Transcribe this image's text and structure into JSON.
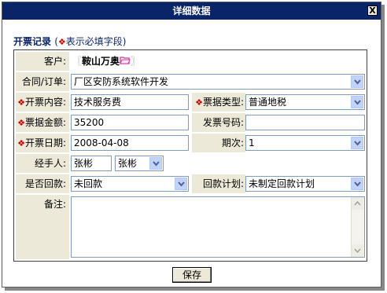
{
  "window": {
    "title": "详细数据",
    "close_label": "X"
  },
  "section": {
    "title": "开票记录",
    "legend_open": "(",
    "legend_mark": "❖",
    "legend_text": "表示必填字段",
    "legend_close": ")"
  },
  "required_mark": "❖",
  "fields": {
    "client": {
      "label": "客户:",
      "bracket_open": "〖",
      "value": "鞍山万奥",
      "bracket_close": "〗"
    },
    "contract": {
      "label": "合同/订单:",
      "value": "厂区安防系统软件开发"
    },
    "invoice_content": {
      "label": "开票内容:",
      "value": "技术服务费"
    },
    "invoice_type": {
      "label": "票据类型:",
      "value": "普通地税"
    },
    "amount": {
      "label": "票据金额:",
      "value": "35200"
    },
    "invoice_number": {
      "label": "发票号码:",
      "value": ""
    },
    "invoice_date": {
      "label": "开票日期:",
      "value": "2008-04-08"
    },
    "period": {
      "label": "期次:",
      "value": "1"
    },
    "handler": {
      "label": "经手人:",
      "value": "张彬",
      "select_value": "张彬"
    },
    "paid_back": {
      "label": "是否回款:",
      "value": "未回款"
    },
    "payback_plan": {
      "label": "回款计划:",
      "value": "未制定回款计划"
    },
    "remarks": {
      "label": "备注:",
      "value": ""
    }
  },
  "buttons": {
    "save": "保存"
  },
  "colors": {
    "titlebar": "#0a246a",
    "label_bg": "#ece9d8",
    "required": "#cc0000"
  }
}
